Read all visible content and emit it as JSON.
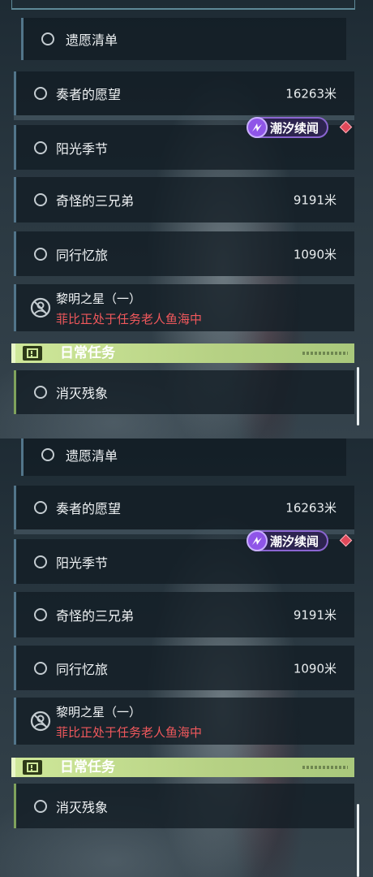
{
  "tracker": {
    "top_task": "遗愿清单",
    "quests": [
      {
        "title": "奏者的愿望",
        "distance": "16263米"
      },
      {
        "title": "阳光季节",
        "distance": ""
      },
      {
        "title": "奇怪的三兄弟",
        "distance": "9191米"
      },
      {
        "title": "同行忆旅",
        "distance": "1090米"
      }
    ],
    "badge": {
      "label": "潮汐续闻",
      "icon": "tide-sigil-icon"
    },
    "marker_icon": "red-diamond-marker-icon",
    "active_quest": {
      "title": "黎明之星（一）",
      "status": "菲比正处于任务老人鱼海中",
      "icon": "face-progress-icon"
    },
    "category": {
      "title": "日常任务",
      "icon": "exclamation-box-icon"
    },
    "daily_quest": {
      "title": "消灭残象"
    }
  },
  "colors": {
    "accent_green": "#cfe89a",
    "status_red": "#f0585c",
    "badge_purple": "#8a65d0",
    "row_bg": "#121c24"
  }
}
